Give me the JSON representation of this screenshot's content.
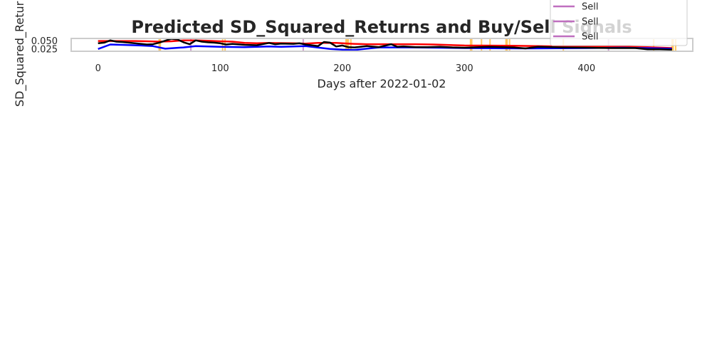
{
  "chart_data": {
    "type": "line",
    "title": "Predicted SD_Squared_Returns and Buy/Sell Signals",
    "xlabel": "Days after 2022-01-02",
    "ylabel": "SD_Squared_Retur",
    "xlim": [
      -22,
      487
    ],
    "ylim": [
      0.018,
      0.058
    ],
    "x_ticks": [
      0,
      100,
      200,
      300,
      400
    ],
    "y_ticks": [
      0.025,
      0.05
    ],
    "y_tick_labels": [
      "0.025",
      "0.050"
    ],
    "grid": false,
    "legend_position": "top-right",
    "series": [
      {
        "color": "#ff0000",
        "x": [
          0,
          30,
          40,
          50,
          60,
          70,
          80,
          90,
          100,
          110,
          120,
          130,
          140,
          160,
          170,
          180,
          195,
          205,
          210,
          220,
          260,
          275,
          300,
          340,
          380,
          420,
          450,
          470
        ],
        "y": [
          0.05,
          0.05,
          0.049,
          0.048,
          0.049,
          0.052,
          0.052,
          0.051,
          0.049,
          0.048,
          0.044,
          0.043,
          0.044,
          0.043,
          0.042,
          0.044,
          0.044,
          0.042,
          0.041,
          0.04,
          0.04,
          0.039,
          0.036,
          0.035,
          0.033,
          0.033,
          0.031,
          0.028
        ]
      },
      {
        "color": "#0000ff",
        "x": [
          0,
          10,
          20,
          35,
          45,
          55,
          70,
          80,
          100,
          120,
          140,
          150,
          160,
          170,
          190,
          200,
          210,
          230,
          260,
          300,
          350,
          400,
          430,
          470
        ],
        "y": [
          0.025,
          0.039,
          0.038,
          0.036,
          0.034,
          0.026,
          0.03,
          0.034,
          0.032,
          0.031,
          0.033,
          0.032,
          0.033,
          0.034,
          0.025,
          0.023,
          0.022,
          0.03,
          0.03,
          0.028,
          0.027,
          0.028,
          0.029,
          0.026
        ]
      },
      {
        "color": "#000000",
        "x": [
          0,
          5,
          10,
          15,
          20,
          30,
          35,
          40,
          45,
          50,
          55,
          60,
          65,
          70,
          75,
          80,
          85,
          90,
          95,
          100,
          105,
          110,
          120,
          130,
          140,
          145,
          150,
          160,
          165,
          170,
          180,
          185,
          190,
          195,
          200,
          205,
          210,
          220,
          230,
          240,
          245,
          250,
          260,
          270,
          280,
          290,
          300,
          320,
          340,
          350,
          360,
          380,
          400,
          420,
          440,
          450,
          460,
          470
        ],
        "y": [
          0.043,
          0.045,
          0.052,
          0.048,
          0.047,
          0.043,
          0.041,
          0.039,
          0.04,
          0.045,
          0.051,
          0.057,
          0.055,
          0.046,
          0.04,
          0.052,
          0.048,
          0.046,
          0.045,
          0.043,
          0.039,
          0.041,
          0.038,
          0.037,
          0.044,
          0.04,
          0.042,
          0.041,
          0.043,
          0.039,
          0.034,
          0.047,
          0.045,
          0.033,
          0.036,
          0.031,
          0.03,
          0.034,
          0.031,
          0.04,
          0.032,
          0.033,
          0.031,
          0.031,
          0.032,
          0.03,
          0.029,
          0.032,
          0.03,
          0.027,
          0.032,
          0.03,
          0.029,
          0.028,
          0.028,
          0.024,
          0.024,
          0.023
        ]
      }
    ],
    "signals": {
      "buy_color": "#ffa500",
      "sell_color": "#bf6fbf",
      "buy_days": [
        50,
        51,
        102,
        104,
        203,
        204,
        205,
        207,
        305,
        306,
        314,
        321,
        334,
        335,
        337,
        381,
        455,
        470,
        471,
        473
      ],
      "sell_days": [
        76,
        168,
        418
      ]
    },
    "legend": {
      "entries": [
        {
          "label": "Sell",
          "color": "#bf6fbf"
        },
        {
          "label": "Sell",
          "color": "#bf6fbf"
        },
        {
          "label": "Sell",
          "color": "#bf6fbf"
        }
      ]
    }
  }
}
